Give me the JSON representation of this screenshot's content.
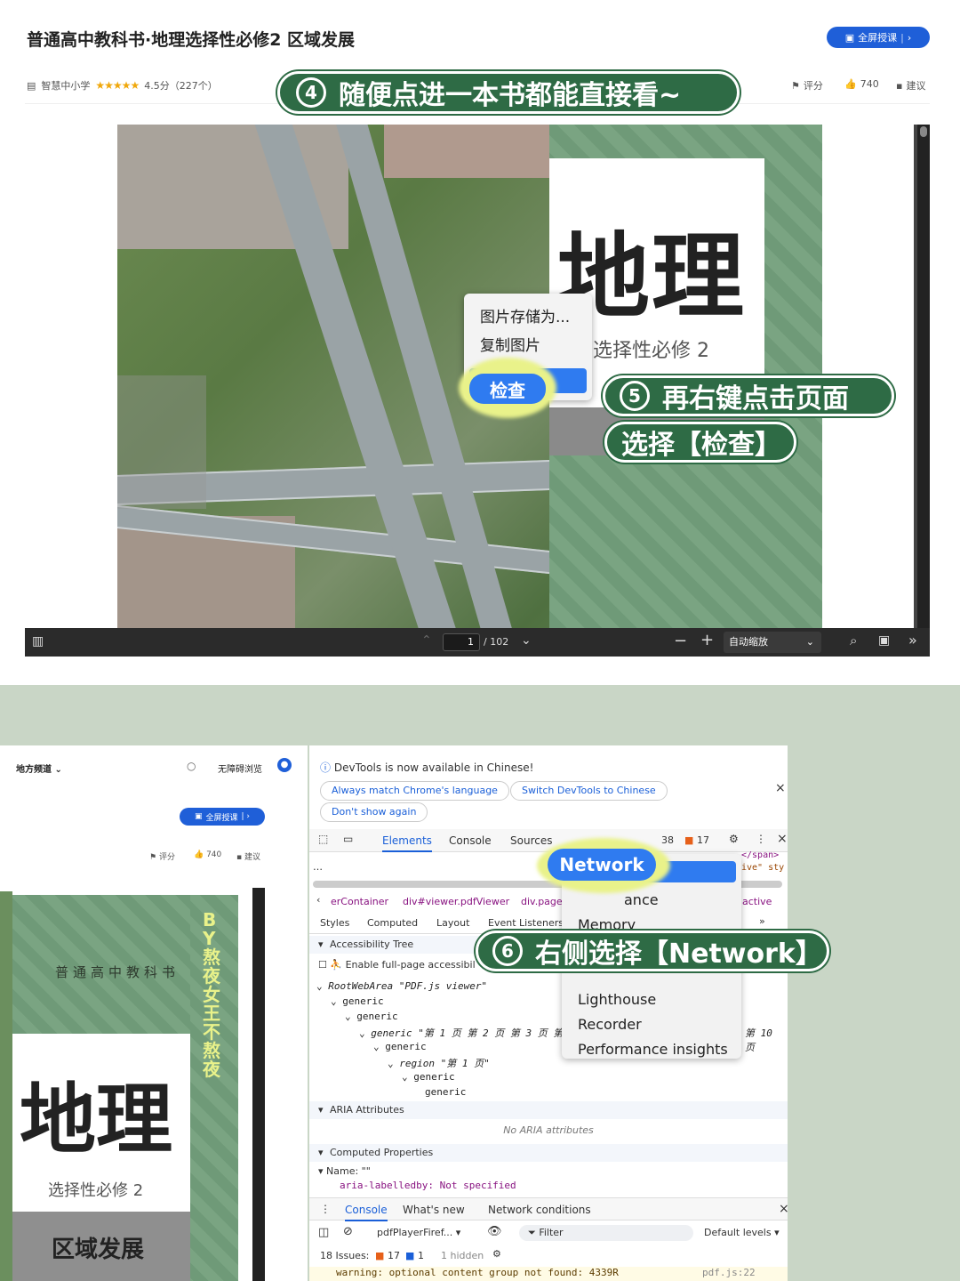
{
  "top": {
    "title": "普通高中教科书·地理选择性必修2 区域发展",
    "full_btn": "全屏授课",
    "publisher": "智慧中小学",
    "stars": "★★★★★",
    "rating": "4.5分（227个）",
    "actions": {
      "rate": "评分",
      "likes": "740",
      "suggest": "建议"
    },
    "step4": {
      "num": "4",
      "text": "随便点进一本书都能直接看~"
    },
    "cover": {
      "big_title": "地理",
      "subtitle": "选择性必修 2"
    },
    "context_menu": {
      "save": "图片存储为...",
      "copy": "复制图片",
      "inspect": "检查"
    },
    "step5": {
      "num": "5",
      "line1": "再右键点击页面",
      "line2": "选择【检查】"
    },
    "toolbar": {
      "page": "1",
      "total": "/ 102",
      "zoom": "自动缩放"
    }
  },
  "bottom": {
    "left": {
      "channel": "地方频道",
      "accessible": "无障碍浏览",
      "full_btn": "全屏授课",
      "rate": "评分",
      "likes": "740",
      "suggest": "建议",
      "book_series": "普通高中教科书",
      "big_title": "地理",
      "subtitle": "选择性必修 2",
      "bottom_title": "区域发展",
      "watermark": "BY熬夜女王不熬夜"
    },
    "devtools": {
      "notice": "DevTools is now available in Chinese!",
      "btn_match": "Always match Chrome's language",
      "btn_switch": "Switch DevTools to Chinese",
      "btn_dont": "Don't show again",
      "tabs": [
        "Elements",
        "Console",
        "Sources"
      ],
      "badge_warn": "38",
      "badge_err": "17",
      "crumbs": [
        "erContainer",
        "div#viewer.pdfViewer",
        "div.page"
      ],
      "crumb_right": "active",
      "code_right1": "</span>",
      "code_right2": "ive\" sty",
      "subtabs": [
        "Styles",
        "Computed",
        "Layout",
        "Event Listeners"
      ],
      "acc_tree": "Accessibility Tree",
      "enable_full": "Enable full-page accessibil",
      "tree": [
        "RootWebArea \"PDF.js viewer\"",
        "generic",
        "generic",
        "generic \"第 1 页 第 2 页 第 3 页 第 4 页",
        "generic",
        "region \"第 1 页\"",
        "generic",
        "generic"
      ],
      "tree_right": "第 10 页",
      "aria_attrs": "ARIA Attributes",
      "no_aria": "No ARIA attributes",
      "computed_props": "Computed Properties",
      "name_line": "Name: \"\"",
      "labelledby": "aria-labelledby: Not specified",
      "drawer_tabs": [
        "Console",
        "What's new",
        "Network conditions"
      ],
      "context_sel": "pdfPlayerFiref...",
      "filter": "Filter",
      "levels": "Default levels",
      "issues": "18 Issues:",
      "issues_err": "17",
      "issues_info": "1",
      "hidden": "1 hidden",
      "warning": "warning: optional content group not found: 4339R",
      "warning_src": "pdf.js:22"
    },
    "menu": {
      "network": "Network",
      "performance_tail": "ance",
      "memory": "Memory",
      "lighthouse": "Lighthouse",
      "recorder": "Recorder",
      "perf_insights": "Performance insights"
    },
    "step6": {
      "num": "6",
      "text": "右侧选择【Network】"
    }
  },
  "colors": {
    "accent": "#1f5fd8",
    "pill": "#2e6b45",
    "highlight": "#e9f28a",
    "cover_green": "#6b8f5e"
  }
}
